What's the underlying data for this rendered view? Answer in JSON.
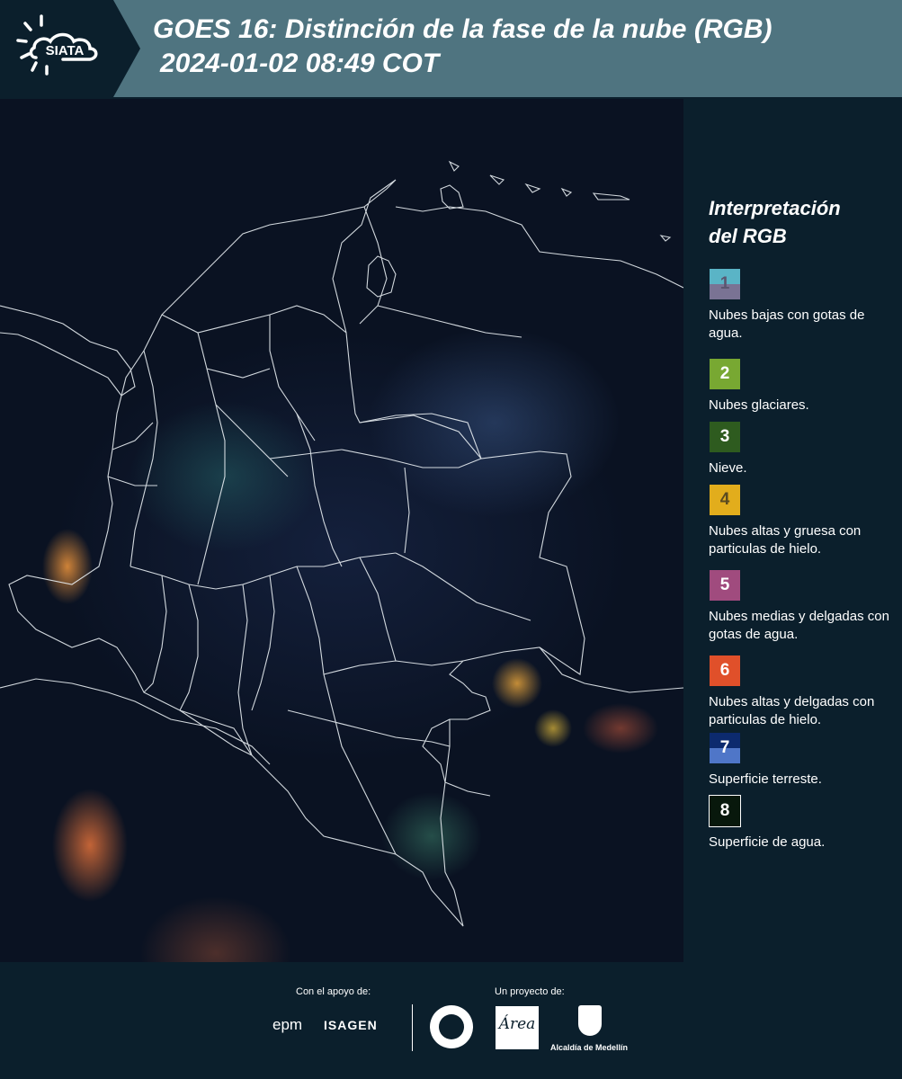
{
  "header": {
    "logo_text": "SIATA",
    "title_line1": "GOES 16: Distinción de la fase de la nube (RGB)",
    "title_line2": "2024-01-02 08:49 COT",
    "background": "#4f7480",
    "logo_background": "#0b1f2c"
  },
  "legend": {
    "title_line1": "Interpretación",
    "title_line2": "del RGB",
    "items": [
      {
        "num": "1",
        "label": "Nubes bajas con gotas de agua.",
        "color_top": "#5ab4c6",
        "color_bottom": "#7a7394",
        "num_color": "#5b5670"
      },
      {
        "num": "2",
        "label": "Nubes glaciares.",
        "color_top": "#78a832",
        "color_bottom": "#78a832",
        "num_color": "#ffffff"
      },
      {
        "num": "3",
        "label": "Nieve.",
        "color_top": "#2e5b1f",
        "color_bottom": "#2e5b1f",
        "num_color": "#ffffff"
      },
      {
        "num": "4",
        "label": "Nubes altas y gruesa con particulas de hielo.",
        "color_top": "#e2ad1c",
        "color_bottom": "#e2ad1c",
        "num_color": "#5a4a20"
      },
      {
        "num": "5",
        "label": "Nubes medias y delgadas con gotas de agua.",
        "color_top": "#a04b7e",
        "color_bottom": "#a04b7e",
        "num_color": "#ffffff"
      },
      {
        "num": "6",
        "label": "Nubes altas y delgadas con particulas de hielo.",
        "color_top": "#e0502a",
        "color_bottom": "#e0502a",
        "num_color": "#ffffff"
      },
      {
        "num": "7",
        "label": "Superficie terreste.",
        "color_top": "#0c2a6e",
        "color_bottom": "#4f76c8",
        "num_color": "#ffffff"
      },
      {
        "num": "8",
        "label": "Superficie de agua.",
        "color_top": "#08180c",
        "color_bottom": "#08180c",
        "num_color": "#ffffff"
      }
    ]
  },
  "footer": {
    "support_label": "Con el apoyo de:",
    "project_label": "Un proyecto de:",
    "sponsor_1": "epm",
    "sponsor_2": "ISAGEN",
    "partner_1_text": "Área",
    "partner_2": "Alcaldía de Medellín"
  }
}
